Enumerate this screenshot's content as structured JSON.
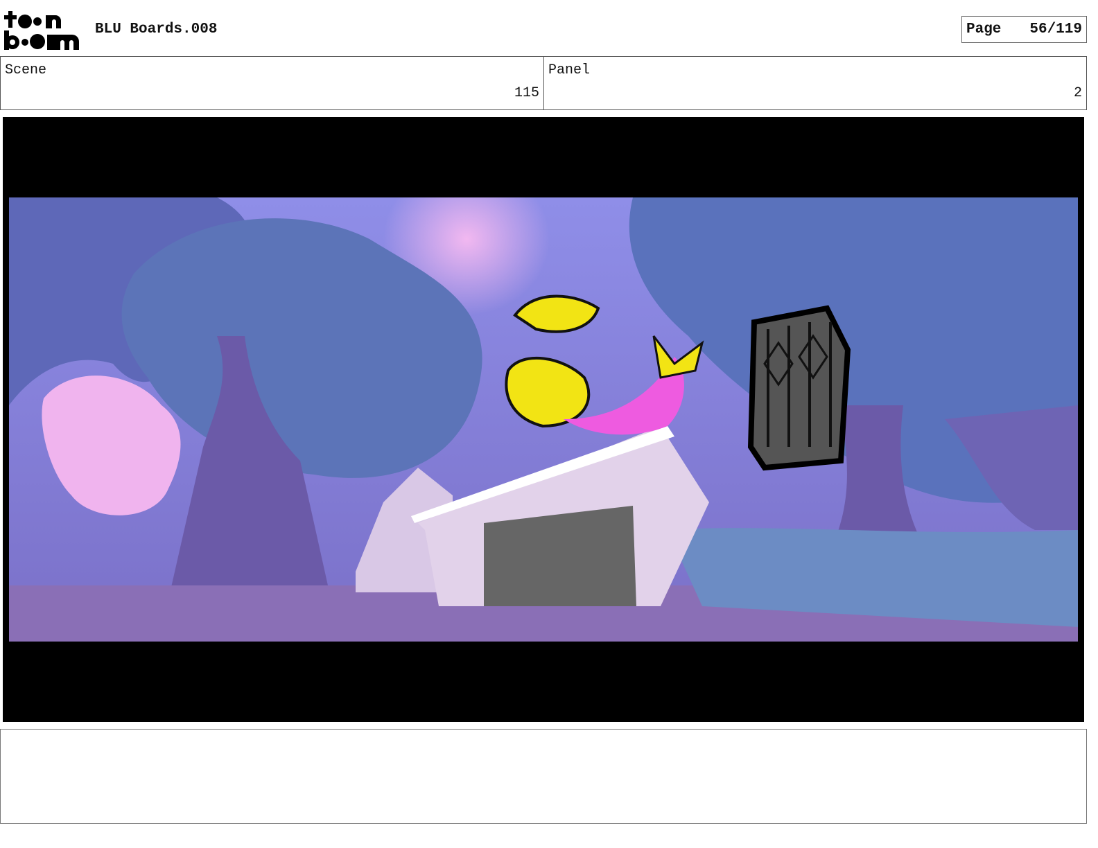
{
  "header": {
    "logo_text": "toon boom",
    "title": "BLU Boards.008",
    "page_label": "Page",
    "page_value": "56/119"
  },
  "scene": {
    "label": "Scene",
    "value": "115"
  },
  "panel": {
    "label": "Panel",
    "value": "2"
  },
  "notes": {
    "text": ""
  }
}
